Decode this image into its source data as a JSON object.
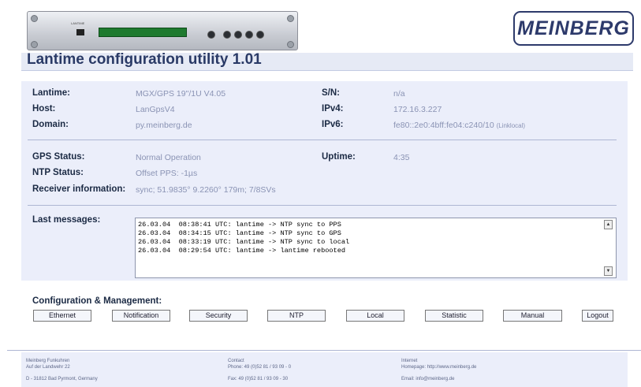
{
  "header": {
    "logo_text": "MEINBERG",
    "title": "Lantime configuration utility 1.01",
    "device_label": "LANTIME"
  },
  "info": {
    "lantime": {
      "label": "Lantime:",
      "value": "MGX/GPS 19\"/1U V4.05"
    },
    "host": {
      "label": "Host:",
      "value": "LanGpsV4"
    },
    "domain": {
      "label": "Domain:",
      "value": "py.meinberg.de"
    },
    "sn": {
      "label": "S/N:",
      "value": "n/a"
    },
    "ipv4": {
      "label": "IPv4:",
      "value": "172.16.3.227"
    },
    "ipv6": {
      "label": "IPv6:",
      "value": "fe80::2e0:4bff:fe04:c240/10",
      "suffix": "(Linklocal)"
    },
    "gps_status": {
      "label": "GPS Status:",
      "value": "Normal Operation"
    },
    "ntp_status": {
      "label": "NTP Status:",
      "value": "Offset PPS: -1µs"
    },
    "receiver": {
      "label": "Receiver information:",
      "value": "sync; 51.9835° 9.2260° 179m; 7/8SVs"
    },
    "uptime": {
      "label": "Uptime:",
      "value": "4:35"
    }
  },
  "messages": {
    "label": "Last messages:",
    "lines": [
      "26.03.04  08:38:41 UTC: lantime -> NTP sync to PPS",
      "26.03.04  08:34:15 UTC: lantime -> NTP sync to GPS",
      "26.03.04  08:33:19 UTC: lantime -> NTP sync to local",
      "26.03.04  08:29:54 UTC: lantime -> lantime rebooted"
    ]
  },
  "config": {
    "title": "Configuration & Management:",
    "buttons": [
      "Ethernet",
      "Notification",
      "Security",
      "NTP",
      "Local",
      "Statistic",
      "Manual",
      "Logout"
    ]
  },
  "footer": {
    "col1": [
      "Meinberg Funkuhren",
      "Auf der Landwehr 22",
      "D - 31812 Bad Pyrmont, Germany"
    ],
    "col2": [
      "Contact",
      "Phone: 49 (0)52 81 / 93 09 - 0",
      "Fax: 49 (0)52 81 / 93 09 - 30"
    ],
    "col3": [
      "Internet",
      "Homepage: http://www.meinberg.de",
      "Email: info@meinberg.de"
    ]
  }
}
